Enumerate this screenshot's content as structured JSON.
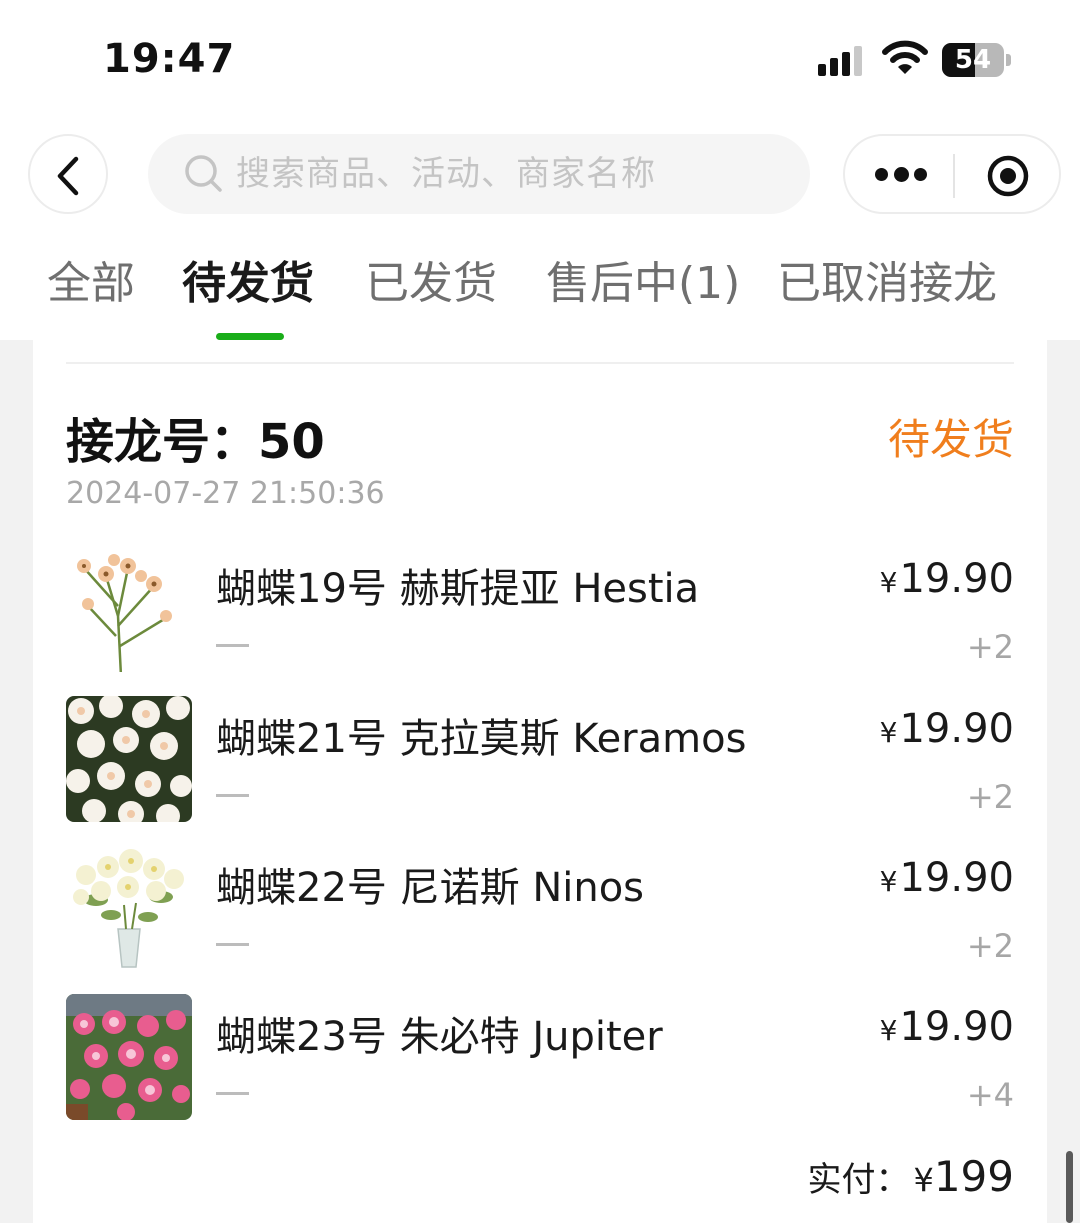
{
  "status_bar": {
    "time": "19:47",
    "battery": "54",
    "battery_level": 0.54
  },
  "header": {
    "search_placeholder": "搜索商品、活动、商家名称"
  },
  "tabs": [
    {
      "label": "全部",
      "active": false
    },
    {
      "label": "待发货",
      "active": true
    },
    {
      "label": "已发货",
      "active": false
    },
    {
      "label": "售后中(1)",
      "active": false
    },
    {
      "label": "已取消接龙",
      "active": false
    }
  ],
  "order": {
    "label": "接龙号：",
    "number": "50",
    "status": "待发货",
    "timestamp": "2024-07-27 21:50:36",
    "items": [
      {
        "name": "蝴蝶19号 赫斯提亚 Hestia",
        "currency": "¥",
        "price": "19.90",
        "option": "—",
        "quantity": "+2",
        "thumb_icon": "peach-cosmos-flower-icon"
      },
      {
        "name": "蝴蝶21号 克拉莫斯 Keramos",
        "currency": "¥",
        "price": "19.90",
        "option": "—",
        "quantity": "+2",
        "thumb_icon": "white-flowers-photo-icon"
      },
      {
        "name": "蝴蝶22号 尼诺斯 Ninos",
        "currency": "¥",
        "price": "19.90",
        "option": "—",
        "quantity": "+2",
        "thumb_icon": "flower-vase-icon"
      },
      {
        "name": "蝴蝶23号 朱必特 Jupiter",
        "currency": "¥",
        "price": "19.90",
        "option": "—",
        "quantity": "+4",
        "thumb_icon": "pink-flowers-photo-icon"
      }
    ],
    "total_label": "实付：",
    "total_currency": "¥",
    "total_amount": "199"
  },
  "colors": {
    "status_orange": "#f07e1d",
    "tab_indicator_green": "#1aad19"
  }
}
